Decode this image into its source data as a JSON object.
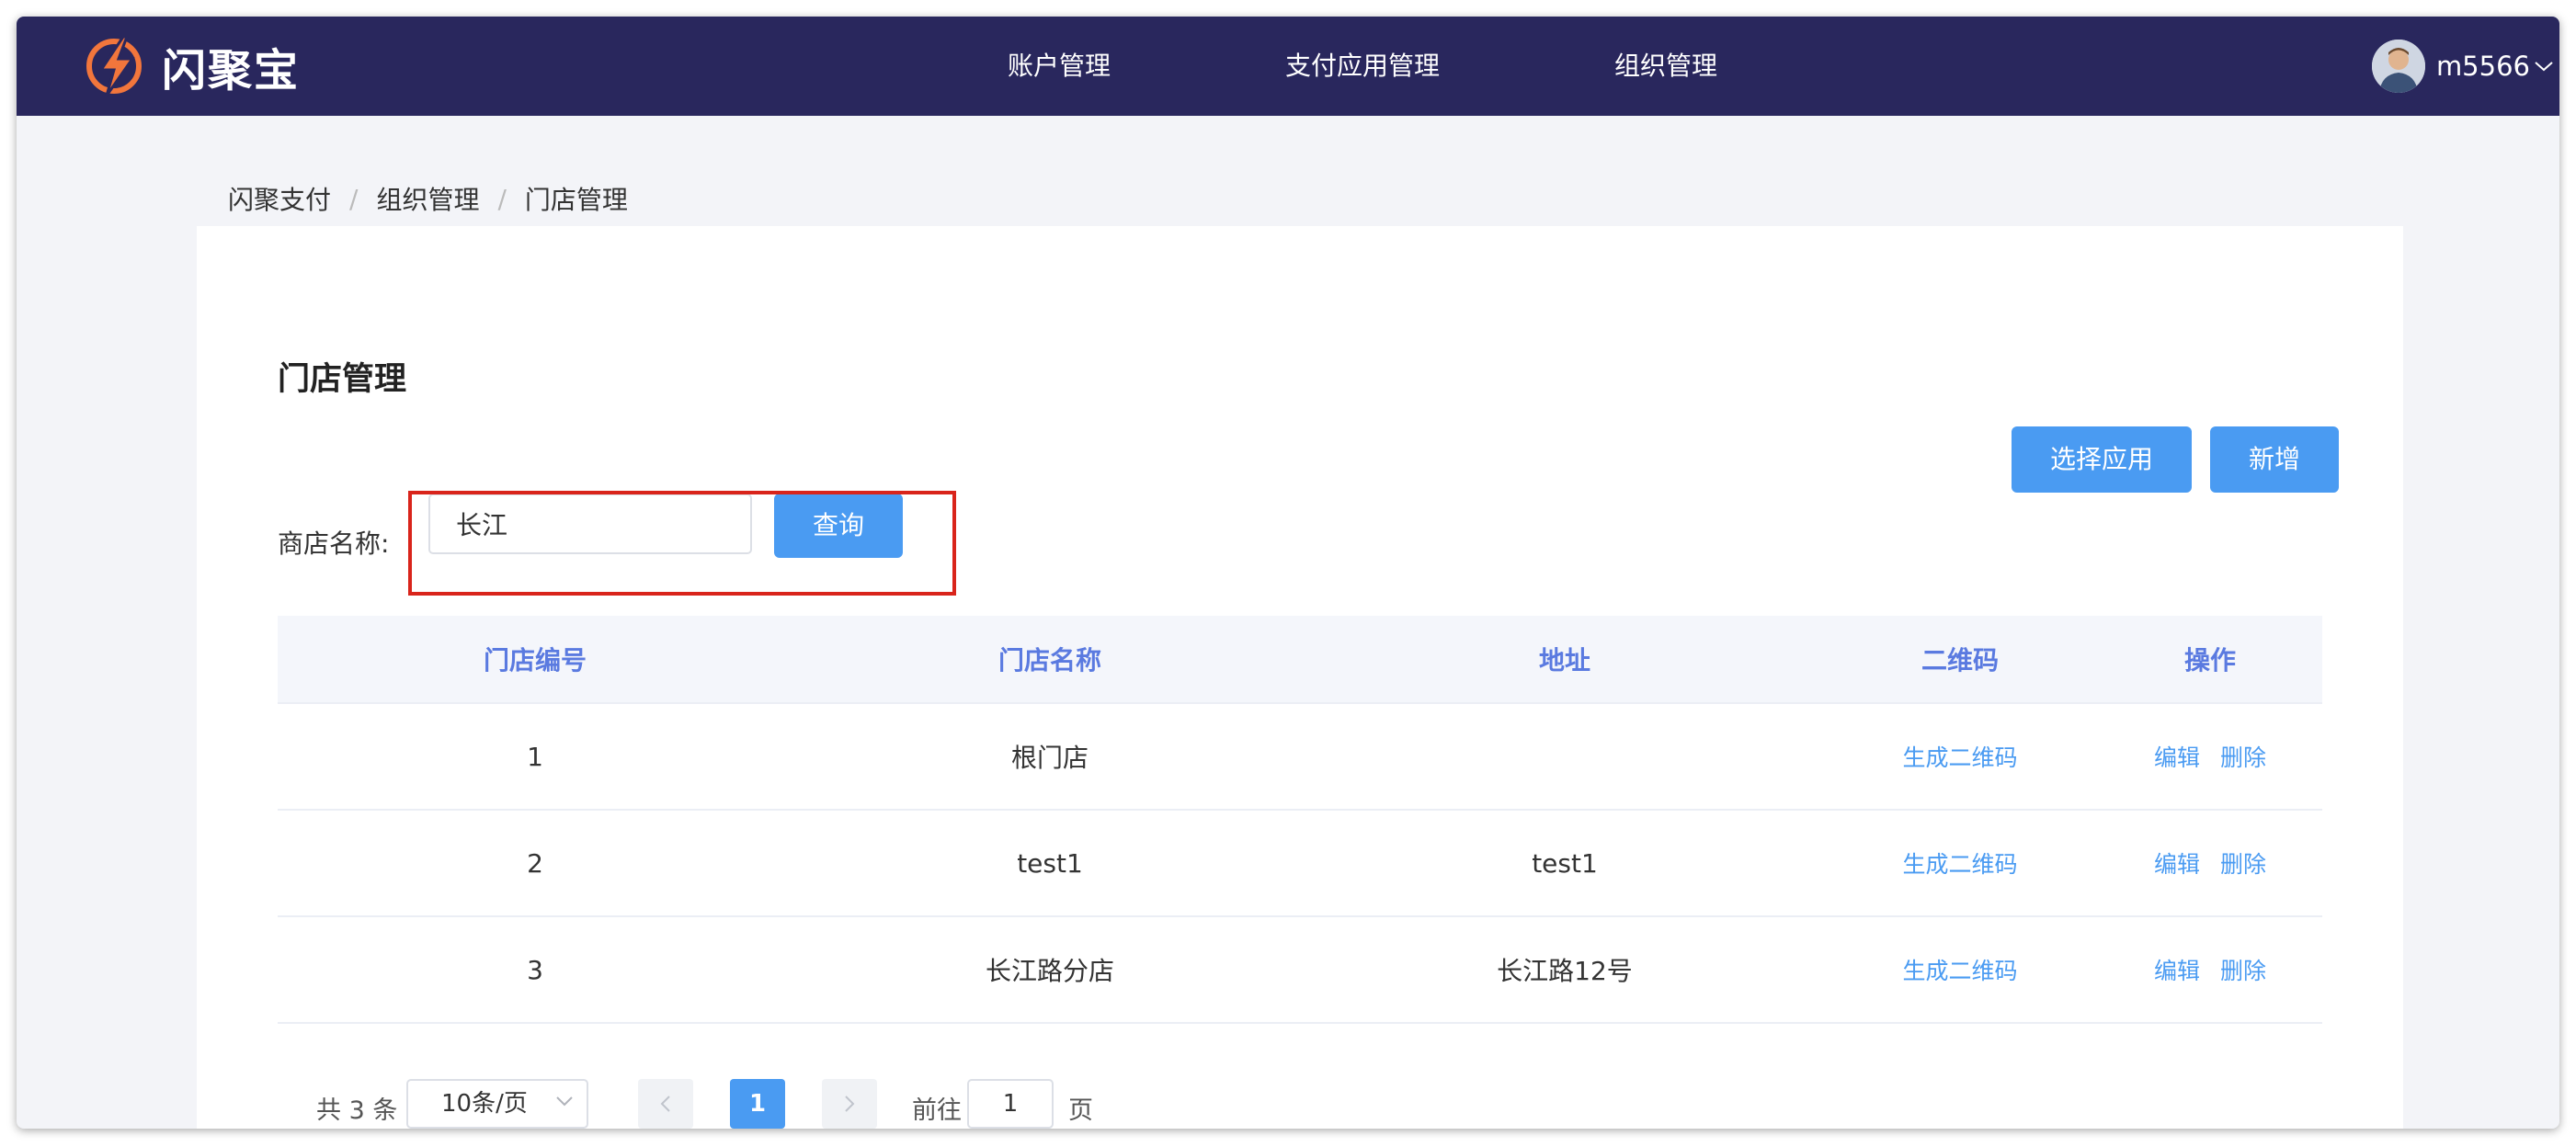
{
  "brand": {
    "name": "闪聚宝"
  },
  "nav": {
    "items": [
      {
        "label": "账户管理"
      },
      {
        "label": "支付应用管理"
      },
      {
        "label": "组织管理"
      }
    ]
  },
  "user": {
    "name": "m5566"
  },
  "breadcrumb": [
    "闪聚支付",
    "组织管理",
    "门店管理"
  ],
  "page": {
    "title": "门店管理",
    "buttons": {
      "select_app": "选择应用",
      "add": "新增"
    },
    "filter": {
      "label": "商店名称:",
      "value": "长江",
      "query": "查询"
    }
  },
  "table": {
    "headers": [
      "门店编号",
      "门店名称",
      "地址",
      "二维码",
      "操作"
    ],
    "rows": [
      {
        "id": "1",
        "name": "根门店",
        "address": "",
        "qrcode": "生成二维码",
        "edit": "编辑",
        "delete": "删除"
      },
      {
        "id": "2",
        "name": "test1",
        "address": "test1",
        "qrcode": "生成二维码",
        "edit": "编辑",
        "delete": "删除"
      },
      {
        "id": "3",
        "name": "长江路分店",
        "address": "长江路12号",
        "qrcode": "生成二维码",
        "edit": "编辑",
        "delete": "删除"
      }
    ]
  },
  "pagination": {
    "total": "共 3 条",
    "page_size": "10条/页",
    "current_page": "1",
    "goto_label": "前往",
    "goto_value": "1",
    "page_suffix": "页"
  },
  "colors": {
    "nav_bg": "#29275d",
    "primary": "#4a9bf2",
    "highlight": "#d9241b",
    "header_text": "#5a7ae0"
  }
}
